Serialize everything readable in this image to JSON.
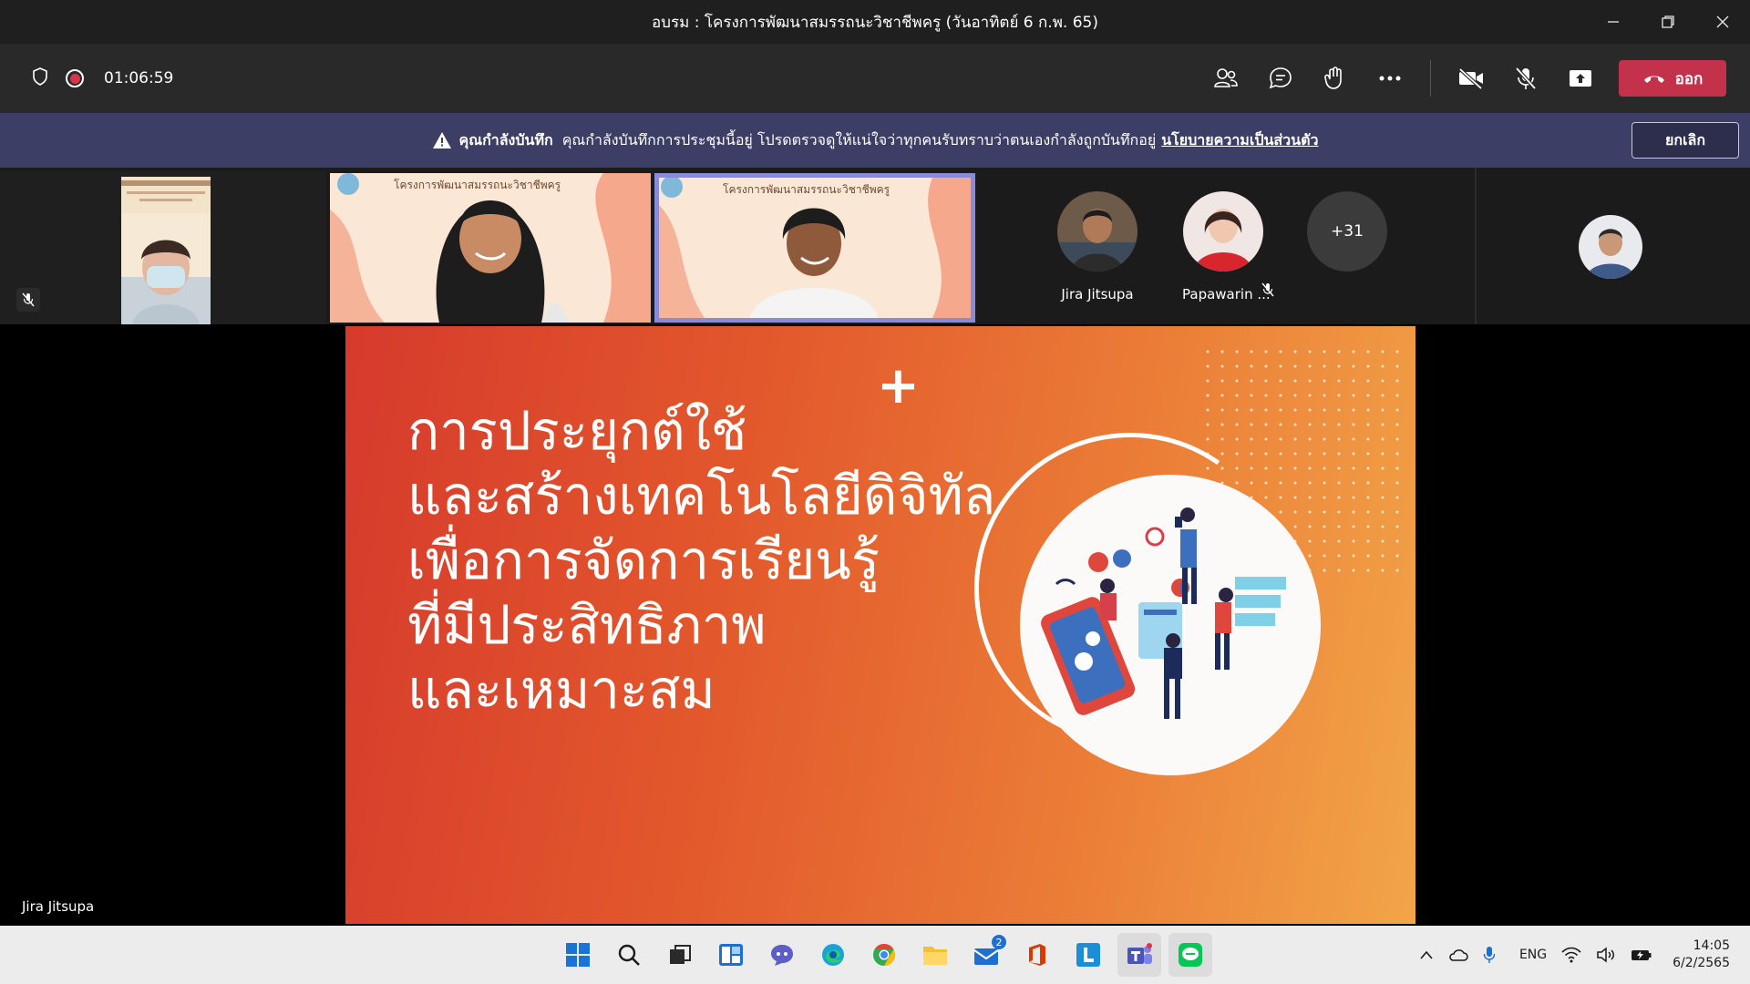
{
  "window": {
    "title": "อบรม : โครงการพัฒนาสมรรถนะวิชาชีพครู (วันอาทิตย์ 6 ก.พ. 65)"
  },
  "toolbar": {
    "timer": "01:06:59",
    "leave_label": "ออก"
  },
  "banner": {
    "title": "คุณกำลังบันทึก",
    "message": "คุณกำลังบันทึกการประชุมนี้อยู่ โปรดตรวจดูให้แน่ใจว่าทุกคนรับทราบว่าตนเองกำลังถูกบันทึกอยู่",
    "link": "นโยบายความเป็นส่วนตัว",
    "cancel_label": "ยกเลิก"
  },
  "participants": {
    "tile_slide_text": "โครงการพัฒนาสมรรถนะวิชาชีพครู",
    "avatars": [
      {
        "name": "Jira Jitsupa"
      },
      {
        "name": "Papawarin ..."
      }
    ],
    "more_count": "+31"
  },
  "stage": {
    "presenter": "Jira Jitsupa",
    "slide_lines": [
      "การประยุกต์ใช้",
      "และสร้างเทคโนโลยีดิจิทัล",
      "เพื่อการจัดการเรียนรู้",
      "ที่มีประสิทธิภาพ",
      "และเหมาะสม"
    ]
  },
  "taskbar": {
    "mail_badge": "2",
    "language": "ENG",
    "time": "14:05",
    "date": "6/2/2565"
  },
  "colors": {
    "leave_red": "#c4314b",
    "banner_purple": "#3d3e66",
    "selected_tile_border": "#8a8bd8"
  }
}
